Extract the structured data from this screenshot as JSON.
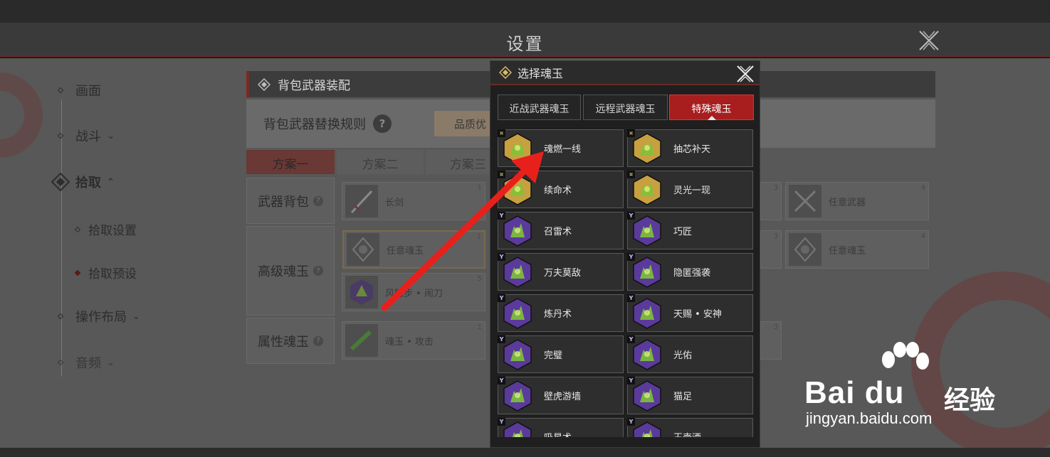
{
  "header": {
    "title": "设置"
  },
  "sidebar": {
    "items": [
      {
        "label": "画面",
        "chevron": ""
      },
      {
        "label": "战斗",
        "chevron": "⌄"
      },
      {
        "label": "拾取",
        "chevron": "⌃"
      },
      {
        "label": "操作布局",
        "chevron": "⌄"
      },
      {
        "label": "音频",
        "chevron": "⌄"
      }
    ],
    "subitems": [
      {
        "label": "拾取设置"
      },
      {
        "label": "拾取预设"
      }
    ]
  },
  "main": {
    "section_title": "背包武器装配",
    "rule_label": "背包武器替换规则",
    "help_glyph": "?",
    "quality_button": "品质优",
    "tabs": [
      {
        "label": "方案一"
      },
      {
        "label": "方案二"
      },
      {
        "label": "方案三"
      }
    ],
    "rows": [
      {
        "label": "武器背包"
      },
      {
        "label": "高级魂玉"
      },
      {
        "label": "属性魂玉"
      }
    ],
    "slots": {
      "weapon_1": {
        "name": "长剑",
        "num": "1"
      },
      "weapon_3": {
        "num": "3"
      },
      "weapon_4": {
        "name": "任意武器",
        "num": "4"
      },
      "adv_1": {
        "name": "任意魂玉",
        "num": "1"
      },
      "adv_3": {
        "num": "3"
      },
      "adv_4": {
        "name": "任意魂玉",
        "num": "4"
      },
      "adv_5": {
        "name": "风隐步 • 闹刀",
        "num": "5"
      },
      "attr_1": {
        "name": "魂玉 • 攻击",
        "num": "1"
      },
      "attr_3": {
        "num": "3"
      }
    }
  },
  "modal": {
    "title": "选择魂玉",
    "tabs": [
      {
        "label": "近战武器魂玉"
      },
      {
        "label": "远程武器魂玉"
      },
      {
        "label": "特殊魂玉"
      }
    ],
    "active_tab": "特殊魂玉",
    "items": [
      {
        "name": "魂燃一线",
        "tier": "gold",
        "badge": "¤"
      },
      {
        "name": "抽芯补天",
        "tier": "gold",
        "badge": "¤"
      },
      {
        "name": "续命术",
        "tier": "gold",
        "badge": "¤"
      },
      {
        "name": "灵光一现",
        "tier": "gold",
        "badge": "¤"
      },
      {
        "name": "召雷术",
        "tier": "purple",
        "badge": "Y"
      },
      {
        "name": "巧匠",
        "tier": "purple",
        "badge": "Y"
      },
      {
        "name": "万夫莫敌",
        "tier": "purple",
        "badge": "Y"
      },
      {
        "name": "隐匿强袭",
        "tier": "purple",
        "badge": "Y"
      },
      {
        "name": "炼丹术",
        "tier": "purple",
        "badge": "Y"
      },
      {
        "name": "天赐 • 安神",
        "tier": "purple",
        "badge": "Y"
      },
      {
        "name": "完璧",
        "tier": "purple",
        "badge": "Y"
      },
      {
        "name": "光佑",
        "tier": "purple",
        "badge": "Y"
      },
      {
        "name": "壁虎游墙",
        "tier": "purple",
        "badge": "Y"
      },
      {
        "name": "猫足",
        "tier": "purple",
        "badge": "Y"
      },
      {
        "name": "吸星术",
        "tier": "purple",
        "badge": "Y"
      },
      {
        "name": "玉壶酒",
        "tier": "purple",
        "badge": "Y"
      }
    ]
  },
  "colors": {
    "accent_red": "#a81e1e",
    "gold": "#c8a040",
    "purple": "#5a3a9a",
    "arrow": "#e02020"
  },
  "watermark": {
    "brand": "Bai du",
    "cn": "经验",
    "url": "jingyan.baidu.com"
  }
}
